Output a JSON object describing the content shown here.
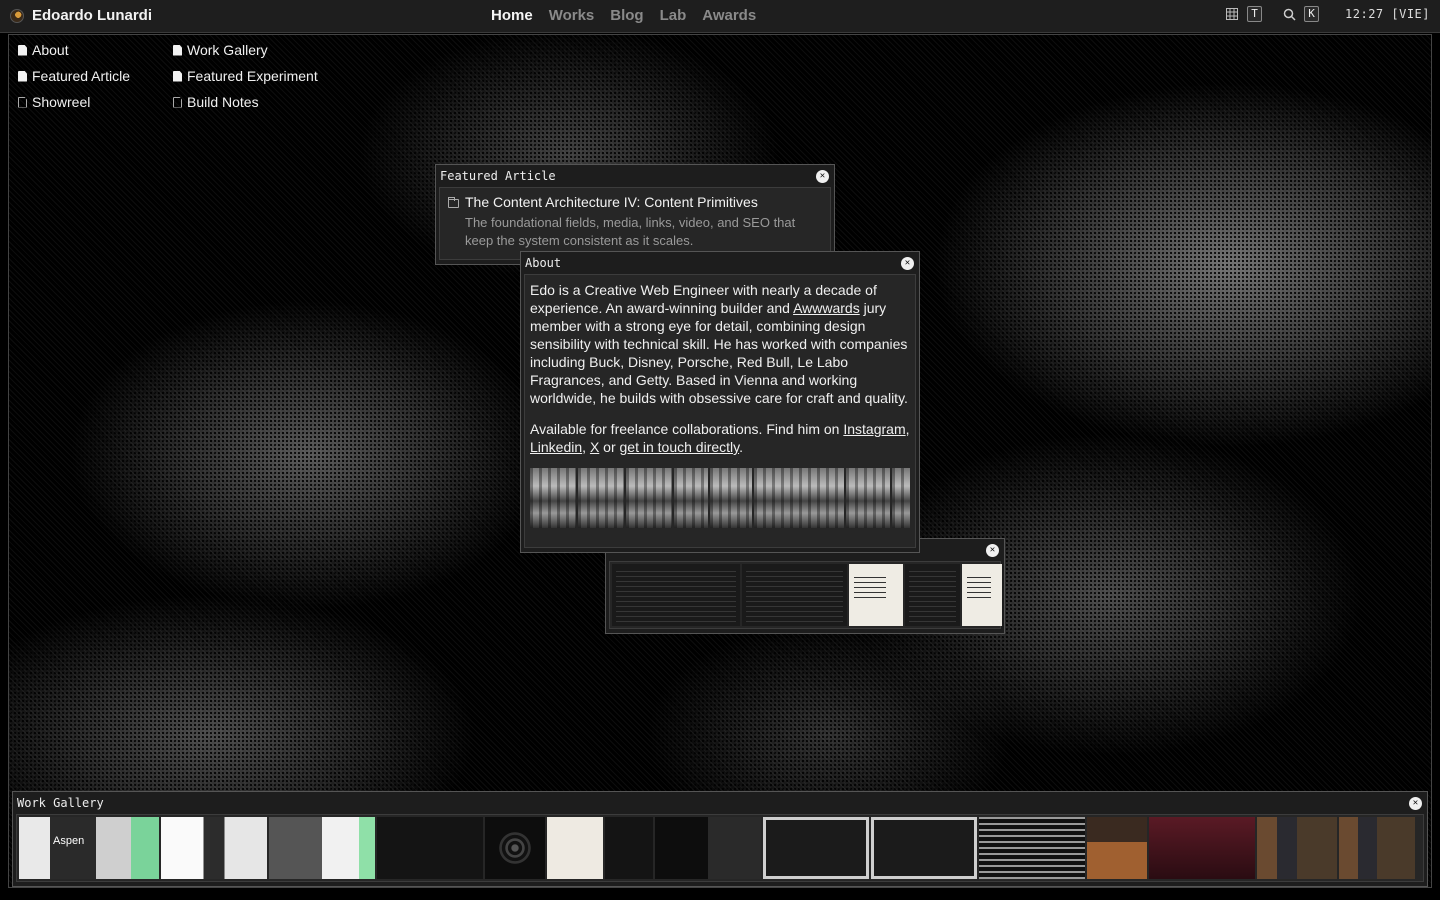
{
  "topbar": {
    "brand": "Edoardo Lunardi",
    "nav": [
      {
        "label": "Home",
        "active": true
      },
      {
        "label": "Works",
        "active": false
      },
      {
        "label": "Blog",
        "active": false
      },
      {
        "label": "Lab",
        "active": false
      },
      {
        "label": "Awards",
        "active": false
      }
    ],
    "theme_key": "T",
    "search_key": "K",
    "clock": "12:27 [VIE]"
  },
  "shortcuts": {
    "about": "About",
    "work_gallery": "Work Gallery",
    "featured_article": "Featured Article",
    "featured_experiment": "Featured Experiment",
    "showreel": "Showreel",
    "build_notes": "Build Notes"
  },
  "featured_article": {
    "title": "Featured Article",
    "article_title": "The Content Architecture IV: Content Primitives",
    "article_desc": "The foundational fields, media, links, video, and SEO that keep the system consistent as it scales."
  },
  "about": {
    "title": "About",
    "p1_before_link": "Edo is a Creative Web Engineer with nearly a decade of experience. An award-winning builder and ",
    "p1_link": "Awwwards",
    "p1_after_link": " jury member with a strong eye for detail, combining design sensibility with technical skill. He has worked with companies including Buck, Disney, Porsche, Red Bull, Le Labo Fragrances, and Getty. Based in Vienna and working worldwide, he builds with obsessive care for craft and quality.",
    "p2_text": "Available for freelance collaborations. Find him on ",
    "link_instagram": "Instagram",
    "sep1": ", ",
    "link_linkedin": "Linkedin",
    "sep2": ", ",
    "link_x": "X",
    "sep3": " or ",
    "link_contact": "get in touch directly",
    "end": "."
  },
  "work_gallery": {
    "title": "Work Gallery",
    "thumb_label": "Aspen"
  },
  "colors": {
    "background": "#000000",
    "menubar": "#1e1e1e",
    "window": "#1d1d1d",
    "window_body": "#262626",
    "text": "#f0f0f0",
    "muted": "#8a8a8a"
  },
  "icons": {
    "brand": "avatar-icon",
    "theme": "grid-icon",
    "search": "search-icon",
    "close": "close-icon",
    "file": "file-icon",
    "folder": "folder-icon"
  }
}
